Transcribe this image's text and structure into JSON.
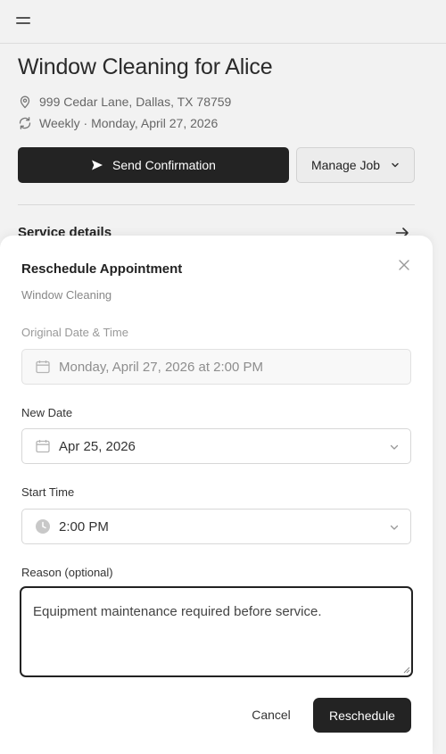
{
  "job": {
    "title": "Window Cleaning for Alice",
    "address": "999 Cedar Lane, Dallas, TX 78759",
    "schedule": "Weekly · Monday, April 27, 2026",
    "send_confirmation_label": "Send Confirmation",
    "manage_job_label": "Manage Job",
    "service_details_label": "Service details"
  },
  "modal": {
    "title": "Reschedule Appointment",
    "subtitle": "Window Cleaning",
    "original_label": "Original Date & Time",
    "original_value": "Monday, April 27, 2026 at 2:00 PM",
    "new_date_label": "New Date",
    "new_date_value": "Apr 25, 2026",
    "start_time_label": "Start Time",
    "start_time_value": "2:00 PM",
    "reason_label": "Reason (optional)",
    "reason_value": "Equipment maintenance required before service.",
    "cancel_label": "Cancel",
    "reschedule_label": "Reschedule"
  },
  "colors": {
    "primary_button": "#232323",
    "background": "#f2f2f2",
    "sheet": "#ffffff"
  },
  "icons": {
    "menu": "menu-icon",
    "location": "map-pin-icon",
    "recurrence": "repeat-icon",
    "send": "send-icon",
    "chevron": "chevron-down-icon",
    "arrow": "arrow-right-icon",
    "close": "close-icon",
    "calendar": "calendar-icon",
    "clock": "clock-icon"
  }
}
